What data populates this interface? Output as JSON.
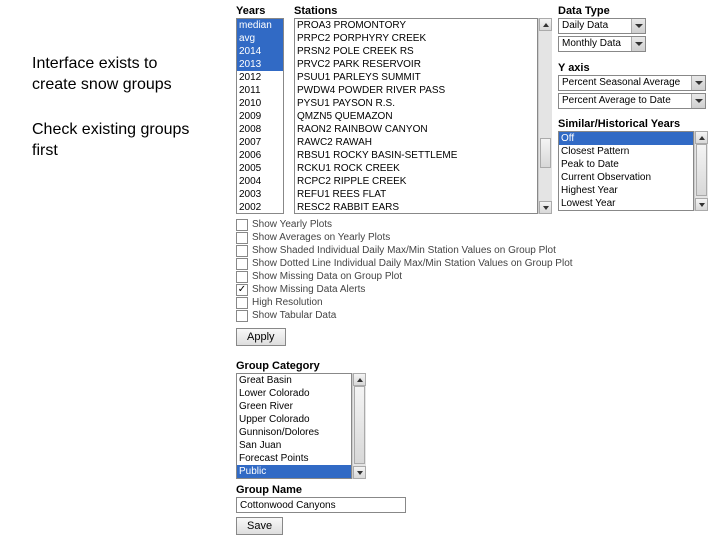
{
  "annotations": {
    "a1_line1": "Interface exists to",
    "a1_line2": "create snow groups",
    "a2_line1": "Check existing groups",
    "a2_line2": "first"
  },
  "years": {
    "label": "Years",
    "items": [
      "median",
      "avg",
      "2014",
      "2013",
      "2012",
      "2011",
      "2010",
      "2009",
      "2008",
      "2007",
      "2006",
      "2005",
      "2004",
      "2003",
      "2002"
    ],
    "selected": [
      "median",
      "avg",
      "2014",
      "2013"
    ]
  },
  "stations": {
    "label": "Stations",
    "items": [
      "PROA3 PROMONTORY",
      "PRPC2 PORPHYRY CREEK",
      "PRSN2 POLE CREEK RS",
      "PRVC2 PARK RESERVOIR",
      "PSUU1 PARLEYS SUMMIT",
      "PWDW4 POWDER RIVER PASS",
      "PYSU1 PAYSON R.S.",
      "QMZN5 QUEMAZON",
      "RAON2 RAINBOW CANYON",
      "RAWC2 RAWAH",
      "RBSU1 ROCKY BASIN-SETTLEME",
      "RCKU1 ROCK CREEK",
      "RCPC2 RIPPLE CREEK",
      "REFU1 REES FLAT",
      "RESC2 RABBIT EARS"
    ]
  },
  "dataType": {
    "label": "Data Type",
    "opt1": "Daily Data",
    "opt2": "Monthly Data"
  },
  "yaxis": {
    "label": "Y axis",
    "opt1": "Percent Seasonal Average",
    "opt2": "Percent Average to Date"
  },
  "similar": {
    "label": "Similar/Historical Years",
    "items": [
      "Off",
      "Closest Pattern",
      "Peak to Date",
      "Current Observation",
      "Highest Year",
      "Lowest Year"
    ],
    "selected": "Off"
  },
  "checks": {
    "c0": "Show Yearly Plots",
    "c1": "Show Averages on Yearly Plots",
    "c2": "Show Shaded Individual Daily Max/Min Station Values on Group Plot",
    "c3": "Show Dotted Line Individual Daily Max/Min Station Values on Group Plot",
    "c4": "Show Missing Data on Group Plot",
    "c5": "Show Missing Data Alerts",
    "c6": "High Resolution",
    "c7": "Show Tabular Data"
  },
  "apply": {
    "label": "Apply"
  },
  "groupCategory": {
    "label": "Group Category",
    "items": [
      "Great Basin",
      "Lower Colorado",
      "Green River",
      "Upper Colorado",
      "Gunnison/Dolores",
      "San Juan",
      "Forecast Points",
      "Public"
    ],
    "selected": "Public"
  },
  "groupName": {
    "label": "Group Name",
    "value": "Cottonwood Canyons"
  },
  "save": {
    "label": "Save"
  }
}
